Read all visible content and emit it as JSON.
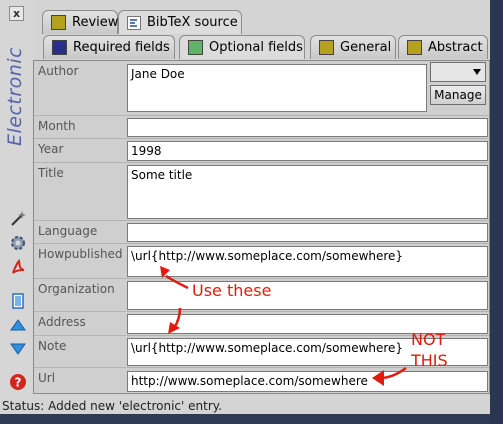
{
  "window": {
    "close_symbol": "x",
    "entry_type": "Electronic"
  },
  "tabs_top": [
    {
      "label": "Review",
      "swatch": "#b5a11d"
    },
    {
      "label": "BibTeX source"
    }
  ],
  "tabs_bottom": [
    {
      "label": "Required fields",
      "swatch": "#2b2e8d"
    },
    {
      "label": "Optional fields",
      "swatch": "#63b06a"
    },
    {
      "label": "General",
      "swatch": "#b5a11d"
    },
    {
      "label": "Abstract",
      "swatch": "#b5a11d"
    }
  ],
  "fields": {
    "author": {
      "label": "Author",
      "value": "Jane Doe"
    },
    "month": {
      "label": "Month",
      "value": ""
    },
    "year": {
      "label": "Year",
      "value": "1998"
    },
    "title": {
      "label": "Title",
      "value": "Some title"
    },
    "language": {
      "label": "Language",
      "value": ""
    },
    "howpublished": {
      "label": "Howpublished",
      "value": "\\url{http://www.someplace.com/somewhere}"
    },
    "organization": {
      "label": "Organization",
      "value": ""
    },
    "address": {
      "label": "Address",
      "value": ""
    },
    "note": {
      "label": "Note",
      "value": "\\url{http://www.someplace.com/somewhere}"
    },
    "url": {
      "label": "Url",
      "value": "http://www.someplace.com/somewhere"
    }
  },
  "manage_label": "Manage",
  "status": "Status:  Added new 'electronic' entry.",
  "annotations": {
    "use_these": "Use these",
    "not_this_1": "NOT",
    "not_this_2": "THIS"
  },
  "left_tools": [
    "magic-wand-icon",
    "gear-icon",
    "pdf-icon",
    "copy-icon",
    "up-arrow-icon",
    "down-arrow-icon",
    "help-icon"
  ],
  "colors": {
    "annotation_red": "#e21b0f",
    "title_blue": "#5565a8"
  }
}
